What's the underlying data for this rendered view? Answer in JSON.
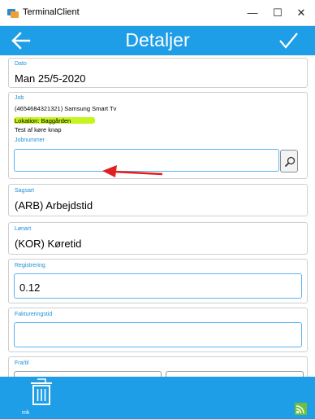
{
  "window": {
    "title": "TerminalClient",
    "minimize": "—",
    "maximize": "☐",
    "close": "✕"
  },
  "appbar": {
    "title": "Detaljer"
  },
  "dato": {
    "label": "Dato",
    "value": "Man 25/5-2020"
  },
  "job": {
    "label": "Job",
    "line1": "(4654684321321) Samsung Smart Tv",
    "line2": "Lokation: Baggården",
    "line3": "Test af køre knap",
    "jobnummer_label": "Jobnummer",
    "jobnummer_value": ""
  },
  "sagsart": {
    "label": "Sagsart",
    "value": "(ARB) Arbejdstid"
  },
  "lonart": {
    "label": "Lønart",
    "value": "(KOR) Køretid"
  },
  "registrering": {
    "label": "Registrering",
    "value": "0.12"
  },
  "faktureringstid": {
    "label": "Faktureringstid",
    "value": ""
  },
  "fratil": {
    "label": "Fra/til"
  },
  "footer": {
    "user": "mk"
  },
  "colors": {
    "accent": "#1e9ee6",
    "highlight": "#c6f41e",
    "arrow": "#e02020",
    "status": "#6fbf3d"
  },
  "icons": [
    "app-icon",
    "back-arrow-icon",
    "checkmark-icon",
    "search-icon",
    "trash-icon",
    "wifi-icon",
    "red-arrow-annotation"
  ]
}
